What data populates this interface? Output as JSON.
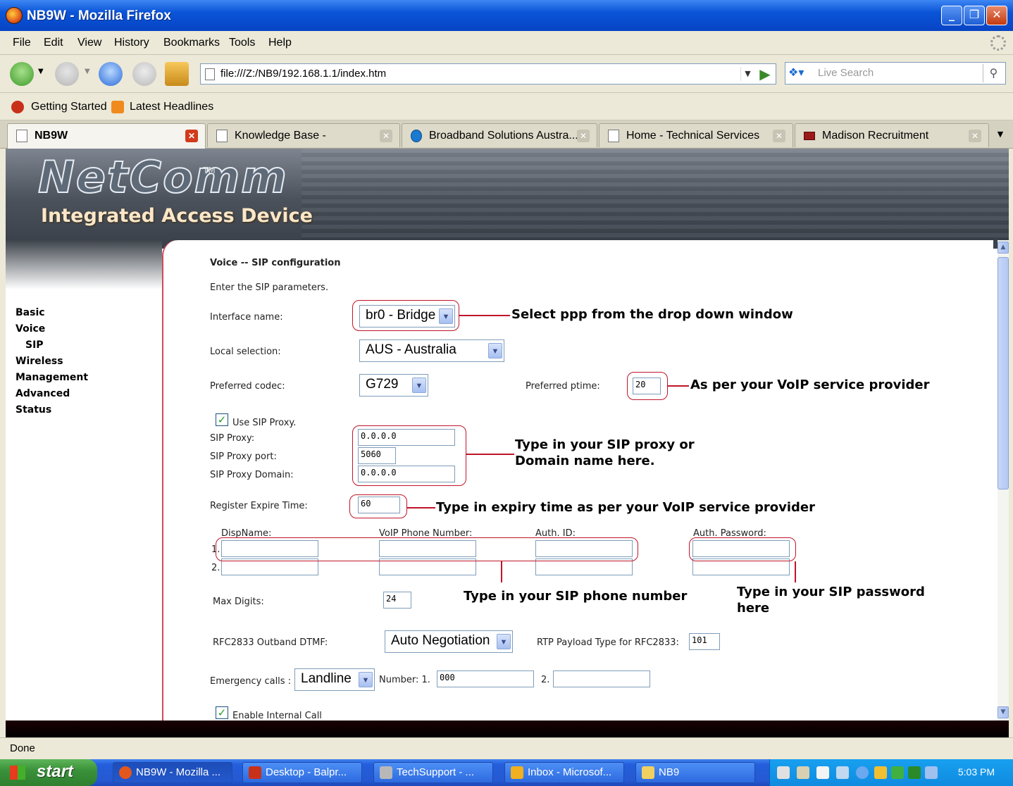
{
  "window": {
    "title": "NB9W - Mozilla Firefox"
  },
  "menu": [
    "File",
    "Edit",
    "View",
    "History",
    "Bookmarks",
    "Tools",
    "Help"
  ],
  "nav": {
    "url": "file:///Z:/NB9/192.168.1.1/index.htm",
    "search_placeholder": "Live Search"
  },
  "bookmarks": [
    "Getting Started",
    "Latest Headlines"
  ],
  "tabs": [
    "NB9W",
    "Knowledge Base -",
    "Broadband Solutions Austra...",
    "Home - Technical Services",
    "Madison Recruitment"
  ],
  "banner": {
    "logo": "NetComm",
    "tm": "TM",
    "subtitle": "Integrated Access Device"
  },
  "sidebar": [
    "Basic",
    "Voice",
    "SIP",
    "Wireless",
    "Management",
    "Advanced",
    "Status"
  ],
  "form": {
    "heading": "Voice -- SIP configuration",
    "intro": "Enter the SIP parameters.",
    "interface_label": "Interface name:",
    "interface_value": "br0 - Bridge",
    "locale_label": "Local selection:",
    "locale_value": "AUS - Australia",
    "codec_label": "Preferred codec:",
    "codec_value": "G729",
    "ptime_label": "Preferred ptime:",
    "ptime_value": "20",
    "use_proxy_label": "Use SIP Proxy.",
    "proxy_label": "SIP Proxy:",
    "proxy_value": "0.0.0.0",
    "proxy_port_label": "SIP Proxy port:",
    "proxy_port_value": "5060",
    "proxy_domain_label": "SIP Proxy Domain:",
    "proxy_domain_value": "0.0.0.0",
    "expire_label": "Register Expire Time:",
    "expire_value": "60",
    "col_dispname": "DispName:",
    "col_phone": "VoIP Phone Number:",
    "col_authid": "Auth. ID:",
    "col_authpw": "Auth. Password:",
    "row1": "1.",
    "row2": "2.",
    "maxdigits_label": "Max Digits:",
    "maxdigits_value": "24",
    "dtmf_label": "RFC2833 Outband DTMF:",
    "dtmf_value": "Auto Negotiation",
    "rtp_label": "RTP Payload Type for RFC2833:",
    "rtp_value": "101",
    "emergency_label": "Emergency calls :",
    "emergency_value": "Landline",
    "number_label": "Number: 1.",
    "number1_value": "000",
    "number2_label": "2.",
    "internal_call_label": "Enable Internal Call"
  },
  "annotations": {
    "interface": "Select ppp from the drop down window",
    "ptime": "As per your VoIP service provider",
    "proxy_line1": "Type in your SIP proxy or",
    "proxy_line2": "Domain name here.",
    "expire": "Type in expiry time as per your VoIP service provider",
    "phone": "Type in your SIP phone number",
    "password_line1": "Type in your SIP password",
    "password_line2": "here"
  },
  "status": "Done",
  "taskbar": {
    "start": "start",
    "tasks": [
      "NB9W - Mozilla ...",
      "Desktop - Balpr...",
      "TechSupport - ...",
      "Inbox - Microsof...",
      "NB9"
    ],
    "clock": "5:03 PM"
  }
}
